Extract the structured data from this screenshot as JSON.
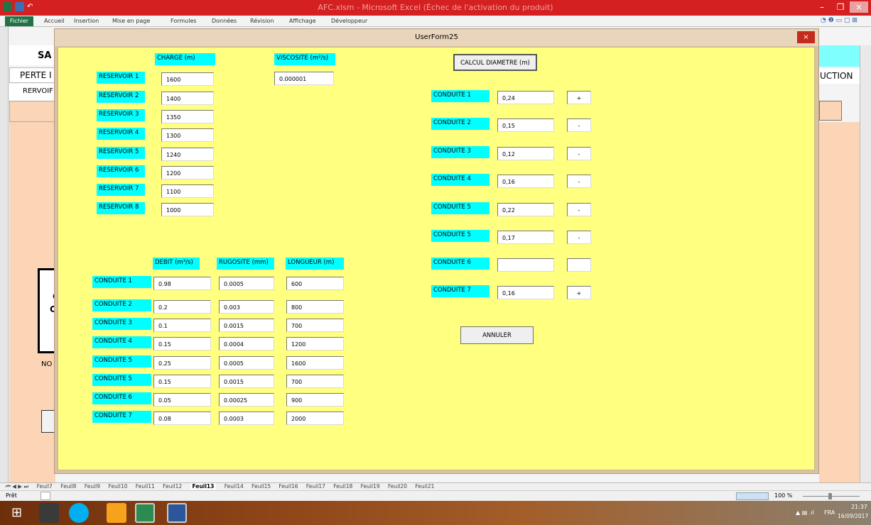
{
  "window": {
    "title": "AFC.xlsm  -  Microsoft Excel (Échec de l'activation du produit)"
  },
  "ribbon": {
    "tabs": [
      "Fichier",
      "Accueil",
      "Insertion",
      "Mise en page",
      "Formules",
      "Données",
      "Révision",
      "Affichage",
      "Développeur"
    ]
  },
  "sheet_bg": {
    "sa": "SA",
    "perte": "PERTE I",
    "rervoir": "RERVOIF",
    "uction": "UCTION",
    "no": "NO",
    "c1": "C",
    "c2": "C"
  },
  "userform": {
    "title": "UserForm25",
    "close": "×"
  },
  "headers": {
    "charge": "CHARGE  (m)",
    "viscosite": "VISCOSITE (m²/s)",
    "debit": "DEBIT  (m³/s)",
    "rugosite": "RUGOSITE  (mm)",
    "longueur": "LONGUEUR  (m)"
  },
  "viscosite_value": "0.000001",
  "reservoirs": [
    {
      "label": "RESERVOIR 1",
      "charge": "1600"
    },
    {
      "label": "RESERVOIR 2",
      "charge": "1400"
    },
    {
      "label": "RESERVOIR 3",
      "charge": "1350"
    },
    {
      "label": "RESERVOIR 4",
      "charge": "1300"
    },
    {
      "label": "RESERVOIR 5",
      "charge": "1240"
    },
    {
      "label": "RESERVOIR 6",
      "charge": "1200"
    },
    {
      "label": "RESERVOIR 7",
      "charge": "1100"
    },
    {
      "label": "RESERVOIR 8",
      "charge": "1000"
    }
  ],
  "conduites": [
    {
      "label": "CONDUITE 1",
      "debit": "0.98",
      "rugosite": "0.0005",
      "longueur": "600"
    },
    {
      "label": "CONDUITE 2",
      "debit": "0.2",
      "rugosite": "0.003",
      "longueur": "800"
    },
    {
      "label": "CONDUITE 3",
      "debit": "0.1",
      "rugosite": "0.0015",
      "longueur": "700"
    },
    {
      "label": "CONDUITE 4",
      "debit": "0.15",
      "rugosite": "0.0004",
      "longueur": "1200"
    },
    {
      "label": "CONDUITE 5",
      "debit": "0.25",
      "rugosite": "0.0005",
      "longueur": "1600"
    },
    {
      "label": "CONDUITE 5",
      "debit": "0.15",
      "rugosite": "0.0015",
      "longueur": "700"
    },
    {
      "label": "CONDUITE 6",
      "debit": "0.05",
      "rugosite": "0.00025",
      "longueur": "900"
    },
    {
      "label": "CONDUITE 7",
      "debit": "0.08",
      "rugosite": "0.0003",
      "longueur": "2000"
    }
  ],
  "results": [
    {
      "label": "CONDUITE 1",
      "diametre": "0,24",
      "sign": "+"
    },
    {
      "label": "CONDUITE 2",
      "diametre": "0,15",
      "sign": "-"
    },
    {
      "label": "CONDUITE 3",
      "diametre": "0,12",
      "sign": "-"
    },
    {
      "label": "CONDUITE 4",
      "diametre": "0,16",
      "sign": "-"
    },
    {
      "label": "CONDUITE 5",
      "diametre": "0,22",
      "sign": "-"
    },
    {
      "label": "CONDUITE 5",
      "diametre": "0,17",
      "sign": "-"
    },
    {
      "label": "CONDUITE 6",
      "diametre": "",
      "sign": ""
    },
    {
      "label": "CONDUITE 7",
      "diametre": "0,16",
      "sign": "+"
    }
  ],
  "buttons": {
    "calcul": "CALCUL  DIAMETRE (m)",
    "annuler": "ANNULER"
  },
  "sheet_tabs": {
    "nav": "⏮ ◀ ▶ ⏭",
    "tabs": [
      "Feuil7",
      "Feuil8",
      "Feuil9",
      "Feuil10",
      "Feuil11",
      "Feuil12",
      "Feuil13",
      "Feuil14",
      "Feuil15",
      "Feuil16",
      "Feuil17",
      "Feuil18",
      "Feuil19",
      "Feuil20",
      "Feuil21"
    ],
    "active": "Feuil13"
  },
  "status": {
    "left": "Prêt",
    "zoom": "100 %"
  },
  "tray": {
    "lang": "FRA",
    "time": "21:37",
    "date": "16/09/2017"
  },
  "colors": {
    "form_bg": "#ffff80",
    "label_bg": "#00ffff",
    "title_bar": "#d42020"
  }
}
